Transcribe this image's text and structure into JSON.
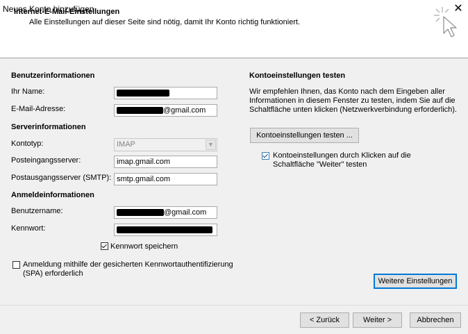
{
  "window": {
    "title": "Neues Konto hinzufügen",
    "close_glyph": "✕"
  },
  "header": {
    "title": "Internet-E-Mail-Einstellungen",
    "subtitle": "Alle Einstellungen auf dieser Seite sind nötig, damit Ihr Konto richtig funktioniert.",
    "icon": "cursor-click-icon"
  },
  "user_info": {
    "heading": "Benutzerinformationen",
    "name_label": "Ihr Name:",
    "email_label": "E-Mail-Adresse:",
    "email_suffix": "@gmail.com"
  },
  "server_info": {
    "heading": "Serverinformationen",
    "account_type_label": "Kontotyp:",
    "account_type_value": "IMAP",
    "incoming_label": "Posteingangsserver:",
    "incoming_value": "imap.gmail.com",
    "outgoing_label": "Postausgangsserver (SMTP):",
    "outgoing_value": "smtp.gmail.com"
  },
  "login_info": {
    "heading": "Anmeldeinformationen",
    "username_label": "Benutzername:",
    "username_suffix": "@gmail.com",
    "password_label": "Kennwort:",
    "save_password_label": "Kennwort speichern",
    "save_password_checked": true,
    "spa_label_line1": "Anmeldung mithilfe der gesicherten Kennwortauthentifizierung",
    "spa_label_line2": "(SPA) erforderlich",
    "spa_checked": false
  },
  "test": {
    "heading": "Kontoeinstellungen testen",
    "description_line1": "Wir empfehlen Ihnen, das Konto nach dem Eingeben aller",
    "description_line2": "Informationen in diesem Fenster zu testen, indem Sie auf die",
    "description_line3": "Schaltfläche unten klicken (Netzwerkverbindung erforderlich).",
    "test_button": "Kontoeinstellungen testen ...",
    "auto_test_line1": "Kontoeinstellungen durch Klicken auf die",
    "auto_test_line2": "Schaltfläche \"Weiter\" testen",
    "auto_test_checked": true
  },
  "buttons": {
    "more_settings": "Weitere Einstellungen",
    "back": "< Zurück",
    "next": "Weiter >",
    "cancel": "Abbrechen"
  }
}
